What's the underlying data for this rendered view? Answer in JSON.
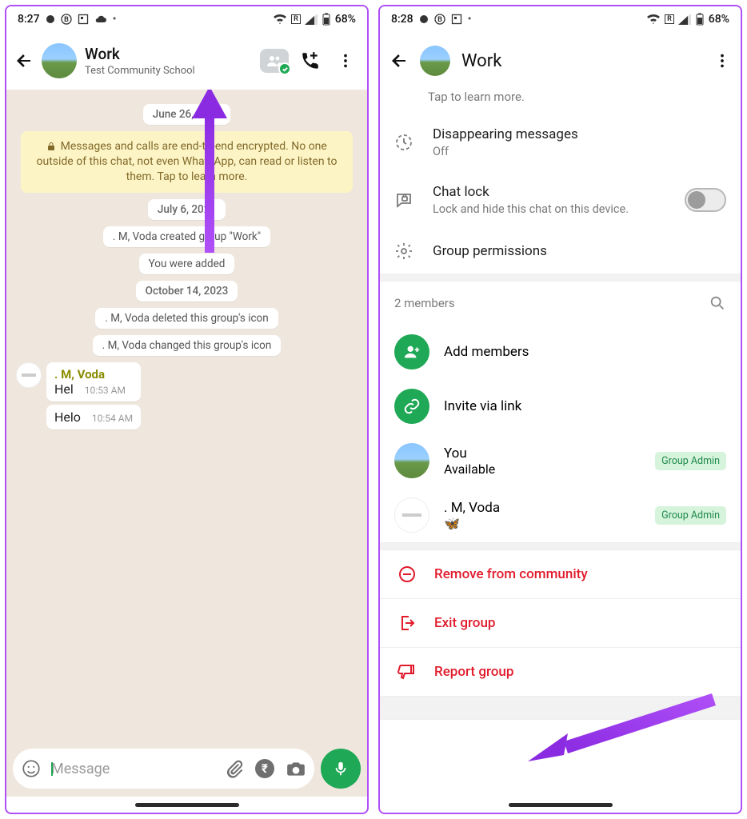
{
  "left": {
    "status": {
      "time": "8:27",
      "battery": "68%",
      "roam": "R"
    },
    "header": {
      "title": "Work",
      "subtitle": "Test Community School"
    },
    "chat": {
      "date1": "June 26, 2022",
      "encryption": "Messages and calls are end-to-end encrypted. No one outside of this chat, not even WhatsApp, can read or listen to them. Tap to learn more.",
      "date2": "July 6, 2021",
      "sys1": ". M, Voda created group \"Work\"",
      "sys2": "You were added",
      "date3": "October 14, 2023",
      "sys3": ". M, Voda deleted this group's icon",
      "sys4": ". M, Voda changed this group's icon",
      "sender": ". M, Voda",
      "msg1_text": "Hel",
      "msg1_time": "10:53 AM",
      "msg2_text": "Helo",
      "msg2_time": "10:54 AM"
    },
    "input": {
      "placeholder": "Message"
    }
  },
  "right": {
    "status": {
      "time": "8:28",
      "battery": "68%",
      "roam": "R"
    },
    "header": {
      "title": "Work"
    },
    "learn_more": "Tap to learn more.",
    "rows": {
      "disappearing_label": "Disappearing messages",
      "disappearing_value": "Off",
      "chatlock_label": "Chat lock",
      "chatlock_sub": "Lock and hide this chat on this device.",
      "permissions_label": "Group permissions"
    },
    "members": {
      "header": "2 members",
      "add": "Add members",
      "invite": "Invite via link",
      "you_name": "You",
      "you_status": "Available",
      "you_badge": "Group Admin",
      "m2_name": ". M, Voda",
      "m2_status": "🦋",
      "m2_badge": "Group Admin"
    },
    "danger": {
      "remove": "Remove from community",
      "exit": "Exit group",
      "report": "Report group"
    }
  }
}
